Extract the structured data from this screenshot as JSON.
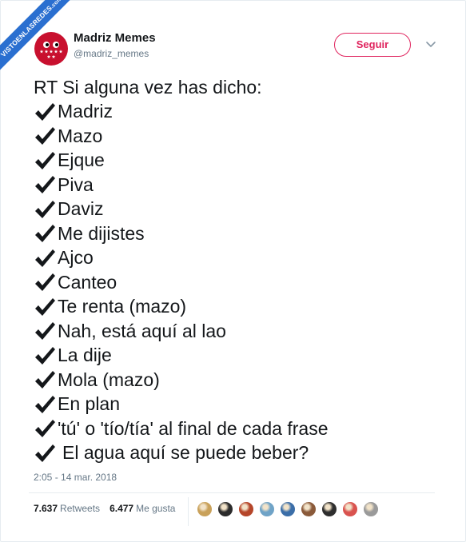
{
  "watermark": {
    "text": "VISTOENLASREDES",
    "suffix": ".com"
  },
  "account": {
    "name": "Madriz Memes",
    "handle": "@madriz_memes"
  },
  "follow_label": "Seguir",
  "tweet": {
    "intro": "RT Si alguna vez has dicho:",
    "items": [
      "Madriz",
      "Mazo",
      "Ejque",
      "Piva",
      "Daviz",
      "Me dijistes",
      "Ajco",
      "Canteo",
      "Te renta (mazo)",
      "Nah, está aquí al lao",
      "La dije",
      "Mola (mazo)",
      "En plan",
      "'tú' o 'tío/tía' al final de cada frase",
      "El agua aquí se puede beber?"
    ],
    "icon": "heavy-check-mark-icon"
  },
  "timestamp": "2:05 - 14 mar. 2018",
  "stats": {
    "retweets_count": "7.637",
    "retweets_label": "Retweets",
    "likes_count": "6.477",
    "likes_label": "Me gusta"
  },
  "likers": [
    {
      "name": "liker-avatar-1",
      "color": "#c9a15a"
    },
    {
      "name": "liker-avatar-2",
      "color": "#2b2b2b"
    },
    {
      "name": "liker-avatar-3",
      "color": "#b5462a"
    },
    {
      "name": "liker-avatar-4",
      "color": "#6fa3c7"
    },
    {
      "name": "liker-avatar-5",
      "color": "#3b6ea8"
    },
    {
      "name": "liker-avatar-6",
      "color": "#8a5a3a"
    },
    {
      "name": "liker-avatar-7",
      "color": "#2e2e2e"
    },
    {
      "name": "liker-avatar-8",
      "color": "#d9534f"
    },
    {
      "name": "liker-avatar-9",
      "color": "#9a9a9a"
    }
  ],
  "colors": {
    "accent_follow": "#e0245e",
    "text_primary": "#14171a",
    "text_secondary": "#657786",
    "avatar_red": "#c8102e",
    "watermark_blue": "#2a6fd0"
  }
}
